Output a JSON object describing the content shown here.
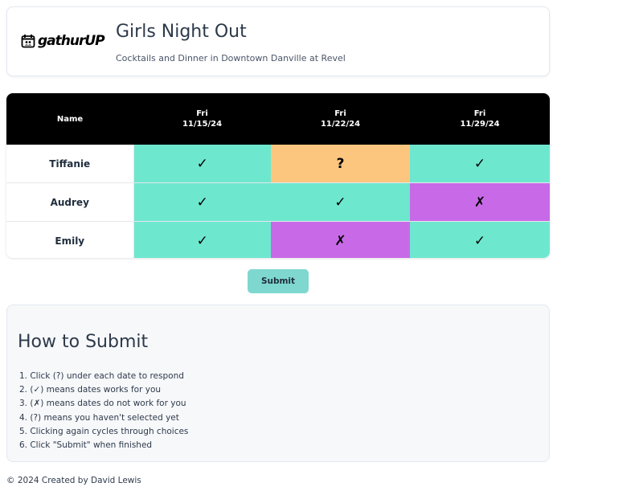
{
  "header": {
    "logo_text": "gathurUP",
    "title": "Girls Night Out",
    "subtitle": "Cocktails and Dinner in Downtown Danville at Revel"
  },
  "poll": {
    "name_header": "Name",
    "dates": [
      {
        "day": "Fri",
        "date": "11/15/24"
      },
      {
        "day": "Fri",
        "date": "11/22/24"
      },
      {
        "day": "Fri",
        "date": "11/29/24"
      }
    ],
    "rows": [
      {
        "name": "Tiffanie",
        "votes": [
          "✓",
          "?",
          "✓"
        ]
      },
      {
        "name": "Audrey",
        "votes": [
          "✓",
          "✓",
          "✗"
        ]
      },
      {
        "name": "Emily",
        "votes": [
          "✓",
          "✗",
          "✓"
        ]
      }
    ],
    "colors": {
      "yes": "#6ee7cf",
      "maybe": "#fdc67f",
      "no": "#c86ae8",
      "header_bg": "#000000"
    }
  },
  "submit_label": "Submit",
  "howto": {
    "title": "How to Submit",
    "steps": [
      "1. Click (?) under each date to respond",
      "2. (✓) means dates works for you",
      "3. (✗) means dates do not work for you",
      "4. (?) means you haven't selected yet",
      "5. Clicking again cycles through choices",
      "6. Click \"Submit\" when finished"
    ]
  },
  "footer": "© 2024 Created by David Lewis"
}
